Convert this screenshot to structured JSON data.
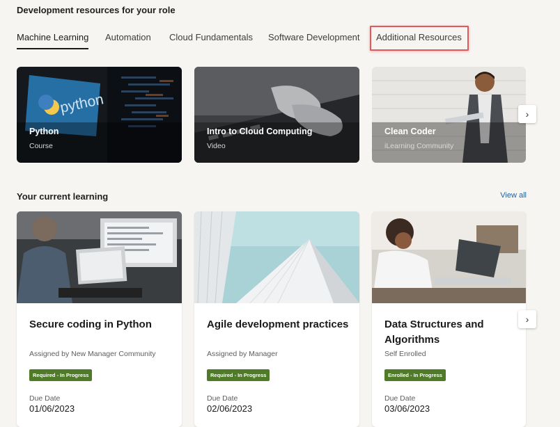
{
  "header": {
    "title": "Development resources for your role"
  },
  "tabs": [
    {
      "label": "Machine Learning"
    },
    {
      "label": "Automation"
    },
    {
      "label": "Cloud Fundamentals"
    },
    {
      "label": "Software Development"
    },
    {
      "label": "Additional Resources"
    }
  ],
  "resources": [
    {
      "title": "Python",
      "type": "Course",
      "image": "python-logo-screen"
    },
    {
      "title": "Intro to Cloud Computing",
      "type": "Video",
      "image": "hands-typing-keyboard"
    },
    {
      "title": "Clean Coder",
      "type": "iLearning Community",
      "image": "man-holding-laptop"
    }
  ],
  "current_learning": {
    "title": "Your current learning",
    "view_all": "View all",
    "cards": [
      {
        "title": "Secure coding in Python",
        "assigned": "Assigned by New Manager Community",
        "status": "Required - In Progress",
        "due_label": "Due Date",
        "due_date": "01/06/2023",
        "image": "developer-at-monitors"
      },
      {
        "title": "Agile development practices",
        "assigned": "Assigned by Manager",
        "status": "Required - In Progress",
        "due_label": "Due Date",
        "due_date": "02/06/2023",
        "image": "building-facade"
      },
      {
        "title": "Data Structures and Algorithms",
        "assigned": "Self Enrolled",
        "status": "Enrolled - In Progress",
        "due_label": "Due Date",
        "due_date": "03/06/2023",
        "image": "woman-on-laptop"
      }
    ]
  },
  "icons": {
    "next": "chevron-right-icon"
  },
  "colors": {
    "badge": "#4f7a28",
    "highlight": "#e0595b",
    "link": "#1f5f99"
  }
}
